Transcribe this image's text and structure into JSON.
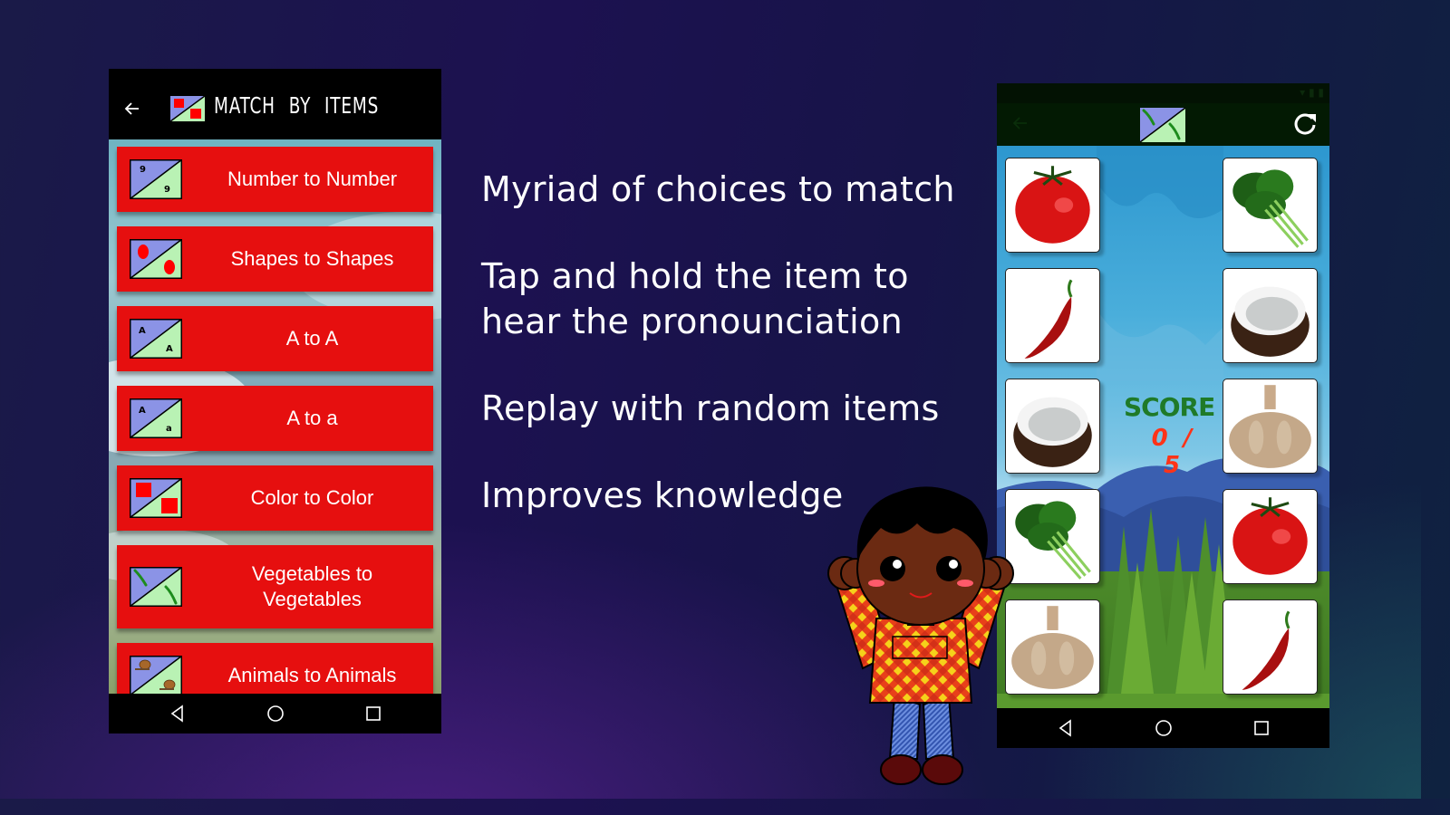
{
  "colors": {
    "menu_red": "#e60f0f",
    "score_green": "#1f7a28",
    "score_red": "#ff3318"
  },
  "left_phone": {
    "app_bar": {
      "back_icon": "arrow-left-icon",
      "logo_icon": "match-logo-icon",
      "title": "MATCH BY ITEMS"
    },
    "menu_items": [
      {
        "label": "Number to Number",
        "icon": "number-match-icon",
        "icon_top": "9",
        "icon_bottom": "9"
      },
      {
        "label": "Shapes to Shapes",
        "icon": "shapes-match-icon"
      },
      {
        "label": "A to A",
        "icon": "letter-match-icon",
        "icon_top": "A",
        "icon_bottom": "A"
      },
      {
        "label": "A to a",
        "icon": "case-match-icon",
        "icon_top": "A",
        "icon_bottom": "a"
      },
      {
        "label": "Color to Color",
        "icon": "color-match-icon"
      },
      {
        "label": "Vegetables to Vegetables",
        "icon": "vegetables-match-icon"
      },
      {
        "label": "Animals to Animals",
        "icon": "animals-match-icon"
      }
    ],
    "nav_bar": [
      "back-triangle-icon",
      "home-circle-icon",
      "recents-square-icon"
    ]
  },
  "features": [
    "Myriad of choices to match",
    "Tap and hold the item to hear the pronounciation",
    "Replay with random items",
    "Improves knowledge"
  ],
  "right_phone": {
    "app_bar": {
      "back_icon": "arrow-left-icon",
      "logo_icon": "vegetables-match-icon",
      "refresh_icon": "refresh-icon"
    },
    "score": {
      "label": "SCORE",
      "value": "0 / 5",
      "current": 0,
      "total": 5
    },
    "left_column": [
      "tomato",
      "chili-pepper",
      "coconut",
      "spinach",
      "garlic"
    ],
    "right_column": [
      "spinach",
      "coconut",
      "garlic",
      "tomato",
      "chili-pepper"
    ],
    "nav_bar": [
      "back-triangle-icon",
      "home-circle-icon",
      "recents-square-icon"
    ]
  },
  "mascot": "cartoon-boy-mascot"
}
